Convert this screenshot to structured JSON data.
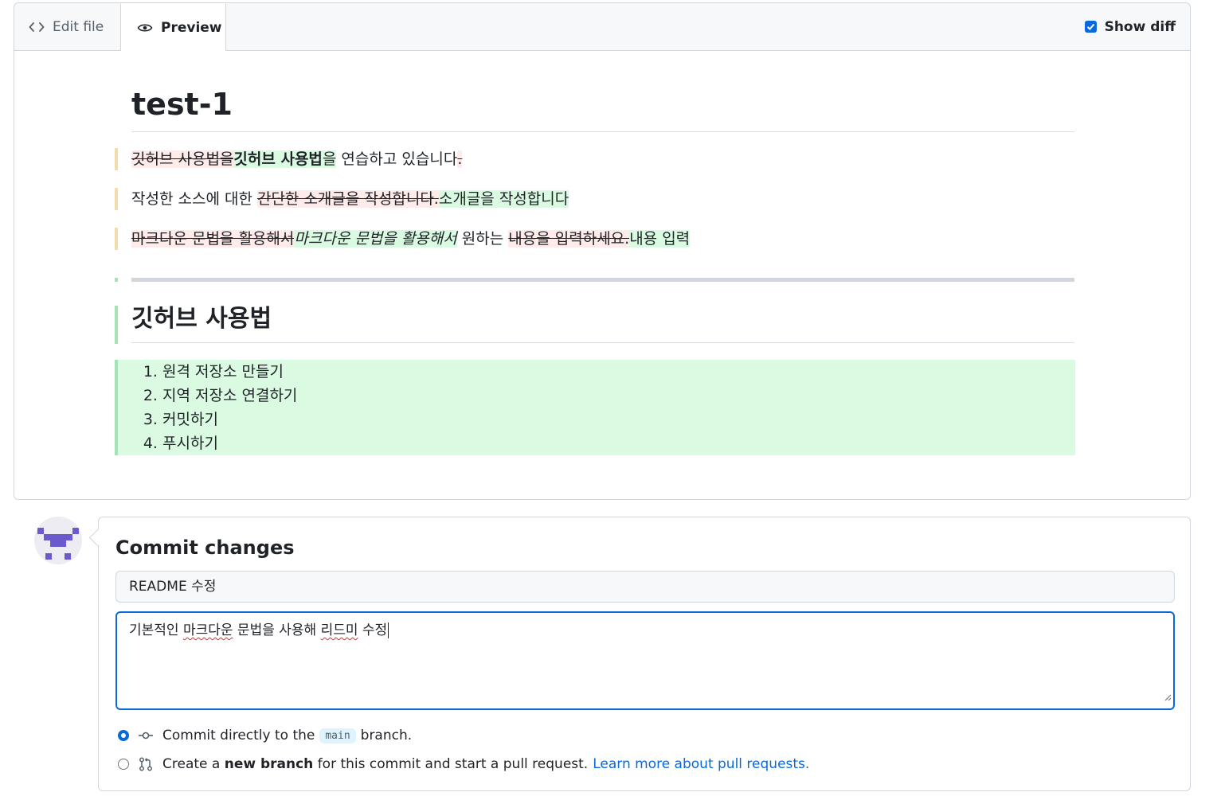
{
  "tabs": {
    "edit_label": "Edit file",
    "preview_label": "Preview",
    "show_diff_label": "Show diff",
    "show_diff_checked": true
  },
  "preview": {
    "h1": "test-1",
    "line1": {
      "del": "깃허브 사용법을",
      "ins_strong": "깃허브 사용법",
      "ins_rest": "을",
      "plain": " 연습하고 있습니다",
      "del_tail": "."
    },
    "line2": {
      "plain": "작성한 소스에 대한 ",
      "del": "간단한 소개글을 작성합니다.",
      "ins": "소개글을 작성합니다"
    },
    "line3": {
      "del": "마크다운 문법을 활용해서",
      "ins_em": "마크다운 문법을 활용해서",
      "plain": " 원하는 ",
      "del2": "내용을 입력하세요.",
      "ins2": "내용 입력"
    },
    "h2": "깃허브 사용법",
    "list": [
      "원격 저장소 만들기",
      "지역 저장소 연결하기",
      "커밋하기",
      "푸시하기"
    ]
  },
  "commit": {
    "title": "Commit changes",
    "summary_value": "README 수정",
    "description": {
      "p1": "기본적인 ",
      "w1": "마크다운",
      "p2": " 문법을 사용해 ",
      "w2": "리드미",
      "p3": " 수정"
    },
    "option_direct": {
      "before": "Commit directly to the",
      "branch": "main",
      "after": "branch.",
      "selected": true
    },
    "option_new": {
      "before": "Create a",
      "bold": "new branch",
      "after": "for this commit and start a pull request.",
      "link": "Learn more about pull requests.",
      "selected": false
    }
  },
  "colors": {
    "accent": "#0969da",
    "deleted_bg": "#ffebe9",
    "inserted_bg": "#dafbe1",
    "changed_marker": "#f0dcac",
    "added_marker": "#a6e3b4",
    "avatar_color": "#6a5acd"
  },
  "icons": {
    "edit_tab": "code-icon",
    "preview_tab": "eye-icon",
    "direct_commit": "git-commit-icon",
    "new_branch": "git-pull-request-icon"
  }
}
